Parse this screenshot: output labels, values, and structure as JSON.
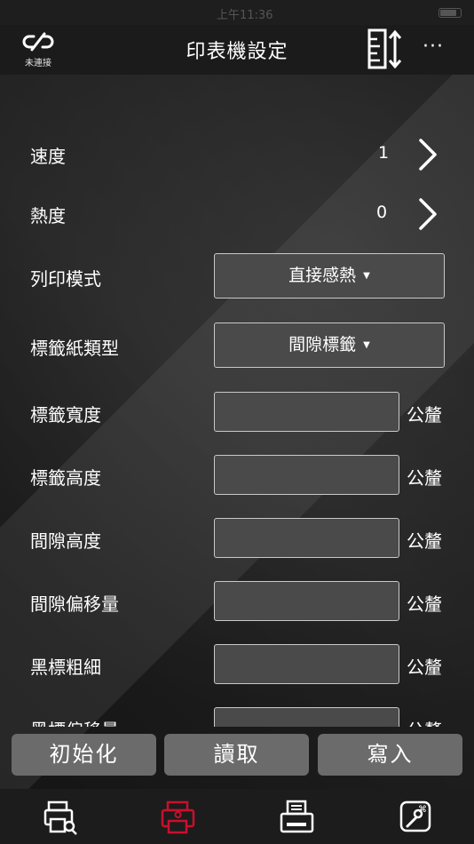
{
  "status_bar": {
    "time": "上午11:36"
  },
  "nav": {
    "connection_label": "未連接",
    "title": "印表機設定",
    "more_label": "···"
  },
  "settings": {
    "speed": {
      "label": "速度",
      "value": "1"
    },
    "density": {
      "label": "熱度",
      "value": "0"
    },
    "print_mode": {
      "label": "列印模式",
      "selected": "直接感熱"
    },
    "label_type": {
      "label": "標籤紙類型",
      "selected": "間隙標籤"
    },
    "label_width": {
      "label": "標籤寬度",
      "value": "",
      "unit": "公釐"
    },
    "label_height": {
      "label": "標籤高度",
      "value": "",
      "unit": "公釐"
    },
    "gap_height": {
      "label": "間隙高度",
      "value": "",
      "unit": "公釐"
    },
    "gap_offset": {
      "label": "間隙偏移量",
      "value": "",
      "unit": "公釐"
    },
    "black_mark_width": {
      "label": "黑標粗細",
      "value": "",
      "unit": "公釐"
    },
    "black_mark_offset": {
      "label": "黑標偏移量",
      "value": "",
      "unit": "公釐"
    }
  },
  "actions": {
    "initialize": "初始化",
    "read": "讀取",
    "write": "寫入"
  },
  "tabs": [
    {
      "icon": "printer-search-icon"
    },
    {
      "icon": "printer-settings-icon",
      "active": true
    },
    {
      "icon": "print-job-icon"
    },
    {
      "icon": "tools-icon"
    }
  ],
  "colors": {
    "active_tab": "#c8102e",
    "button_bg": "#6b6b6b",
    "field_bg": "#4a4a4a"
  }
}
